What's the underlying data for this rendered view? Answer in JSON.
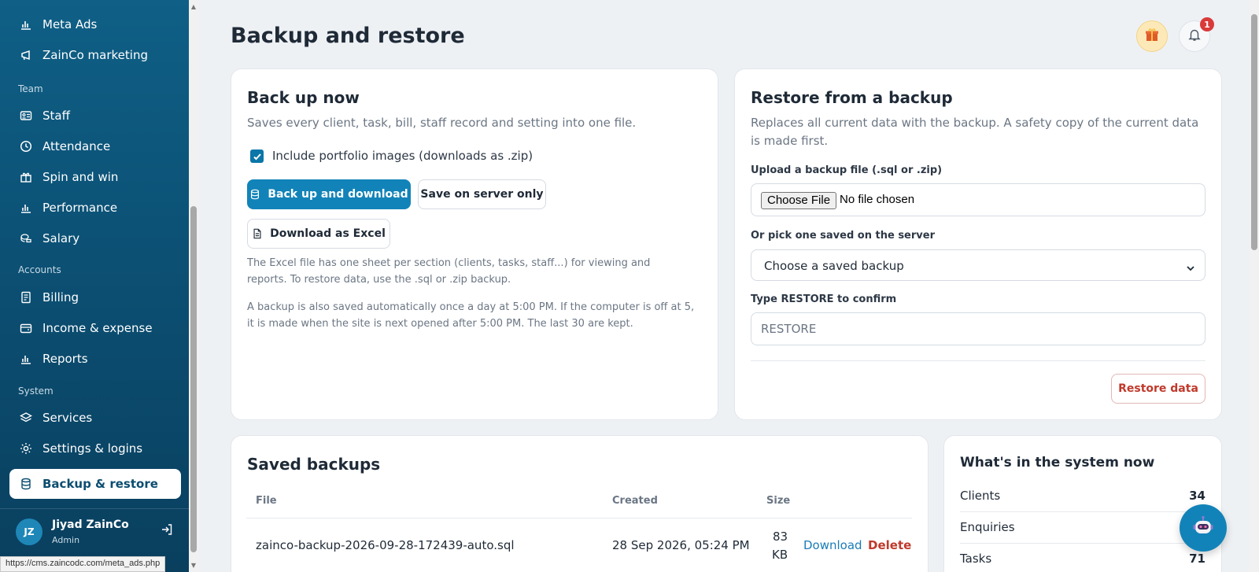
{
  "sidebar": {
    "items": [
      {
        "label": "Meta Ads",
        "icon": "bar-chart-icon"
      },
      {
        "label": "ZainCo marketing",
        "icon": "megaphone-icon"
      },
      {
        "label": "Staff",
        "icon": "id-card-icon"
      },
      {
        "label": "Attendance",
        "icon": "clock-icon"
      },
      {
        "label": "Spin and win",
        "icon": "gift-icon"
      },
      {
        "label": "Performance",
        "icon": "bar-chart-icon"
      },
      {
        "label": "Salary",
        "icon": "coins-icon"
      },
      {
        "label": "Billing",
        "icon": "receipt-icon"
      },
      {
        "label": "Income & expense",
        "icon": "wallet-icon"
      },
      {
        "label": "Reports",
        "icon": "bar-chart-icon"
      },
      {
        "label": "Services",
        "icon": "layers-icon"
      },
      {
        "label": "Settings & logins",
        "icon": "sun-gear-icon"
      },
      {
        "label": "Backup & restore",
        "icon": "database-icon"
      }
    ],
    "sections": {
      "team": "Team",
      "accounts": "Accounts",
      "system": "System"
    },
    "user": {
      "initials": "JZ",
      "name": "Jiyad ZainCo",
      "role": "Admin"
    }
  },
  "status_url": "https://cms.zaincodc.com/meta_ads.php",
  "header": {
    "title": "Backup and restore",
    "notification_count": "1"
  },
  "backup": {
    "title": "Back up now",
    "subtitle": "Saves every client, task, bill, staff record and setting into one file.",
    "include_images_label": "Include portfolio images (downloads as .zip)",
    "include_images_checked": true,
    "backup_download_label": "Back up and download",
    "save_server_label": "Save on server only",
    "download_excel_label": "Download as Excel",
    "excel_note": "The Excel file has one sheet per section (clients, tasks, staff...) for viewing and reports. To restore data, use the .sql or .zip backup.",
    "auto_note": "A backup is also saved automatically once a day at 5:00 PM. If the computer is off at 5, it is made when the site is next opened after 5:00 PM. The last 30 are kept."
  },
  "restore": {
    "title": "Restore from a backup",
    "subtitle": "Replaces all current data with the backup. A safety copy of the current data is made first.",
    "upload_label": "Upload a backup file (.sql or .zip)",
    "choose_file": "Choose File",
    "no_file": "No file chosen",
    "pick_label": "Or pick one saved on the server",
    "select_value": "Choose a saved backup",
    "confirm_label": "Type RESTORE to confirm",
    "confirm_placeholder": "RESTORE",
    "restore_button": "Restore data"
  },
  "saved": {
    "title": "Saved backups",
    "columns": {
      "file": "File",
      "created": "Created",
      "size": "Size"
    },
    "rows": [
      {
        "file": "zainco-backup-2026-09-28-172439-auto.sql",
        "created": "28 Sep 2026, 05:24 PM",
        "size_num": "83",
        "size_unit": "KB",
        "download": "Download",
        "delete": "Delete"
      }
    ]
  },
  "stats": {
    "title": "What's in the system now",
    "rows": [
      {
        "label": "Clients",
        "value": "34"
      },
      {
        "label": "Enquiries",
        "value": ""
      },
      {
        "label": "Tasks",
        "value": "71"
      }
    ]
  },
  "colors": {
    "primary": "#1283b8",
    "sidebar": "#0b4d70",
    "danger": "#c0392b"
  }
}
